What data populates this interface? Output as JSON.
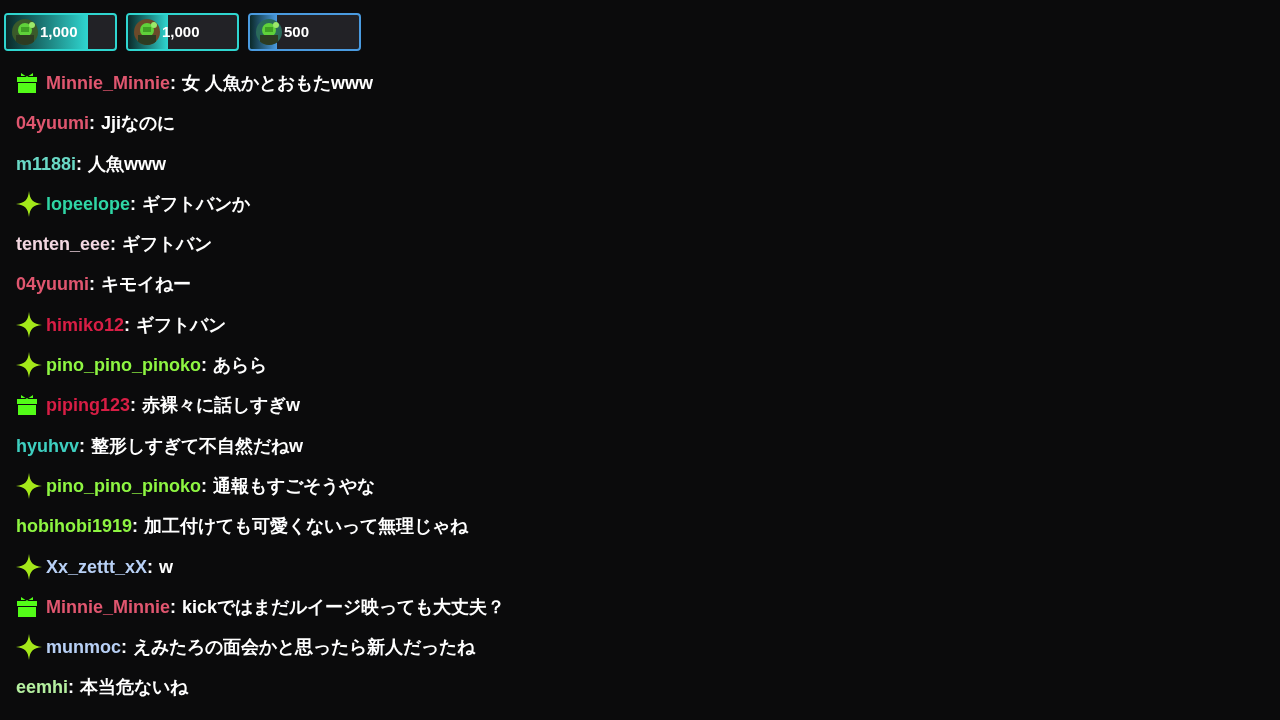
{
  "pinned_gifts": [
    {
      "amount": "1,000",
      "level": 0.75,
      "color": "#2fd6d0"
    },
    {
      "amount": "1,000",
      "level": 0.37,
      "color": "#2fd6d0"
    },
    {
      "amount": "500",
      "level": 0.25,
      "color": "#4a9be0"
    }
  ],
  "messages": [
    {
      "kind": "gift",
      "user": "Minnie_Minnie",
      "color": "#e0566f",
      "separator": ":",
      "text": "女 人魚かとおもたwww"
    },
    {
      "kind": "plain",
      "user": "04yuumi",
      "color": "#e0566f",
      "separator": ":",
      "text": "Jjiなのに"
    },
    {
      "kind": "plain",
      "user": "m1188i",
      "color": "#6ad9c6",
      "separator": ":",
      "text": "人魚www"
    },
    {
      "kind": "star",
      "user": "lopeelope",
      "color": "#2fd6a5",
      "separator": ":",
      "text": "ギフトバンか"
    },
    {
      "kind": "plain",
      "user": "tenten_eee",
      "color": "#f2d6e0",
      "separator": ":",
      "text": "ギフトバン"
    },
    {
      "kind": "plain",
      "user": "04yuumi",
      "color": "#e0566f",
      "separator": ":",
      "text": "キモイねー"
    },
    {
      "kind": "star",
      "user": "himiko12",
      "color": "#d81e45",
      "separator": ":",
      "text": "ギフトバン"
    },
    {
      "kind": "star",
      "user": "pino_pino_pinoko",
      "color": "#8ef542",
      "separator": ":",
      "text": "あらら"
    },
    {
      "kind": "gift",
      "user": "piping123",
      "color": "#d81e45",
      "separator": ":",
      "text": "赤裸々に話しすぎw"
    },
    {
      "kind": "plain",
      "user": "hyuhvv",
      "color": "#3ecfc0",
      "separator": ":",
      "text": "整形しすぎて不自然だねw"
    },
    {
      "kind": "star",
      "user": "pino_pino_pinoko",
      "color": "#8ef542",
      "separator": ":",
      "text": "通報もすごそうやな"
    },
    {
      "kind": "plain",
      "user": "hobihobi1919",
      "color": "#8ef542",
      "separator": ":",
      "text": "加工付けても可愛くないって無理じゃね"
    },
    {
      "kind": "star",
      "user": "Xx_zettt_xX",
      "color": "#b8d0f5",
      "separator": ":",
      "text": "w"
    },
    {
      "kind": "gift",
      "user": "Minnie_Minnie",
      "color": "#e0566f",
      "separator": ":",
      "text": "kickではまだルイージ映っても大丈夫？"
    },
    {
      "kind": "star",
      "user": "munmoc",
      "color": "#b8d0f5",
      "separator": ":",
      "text": "えみたろの面会かと思ったら新人だったね"
    },
    {
      "kind": "plain",
      "user": "eemhi",
      "color": "#b5f0a0",
      "separator": ":",
      "text": "本当危ないね"
    }
  ]
}
